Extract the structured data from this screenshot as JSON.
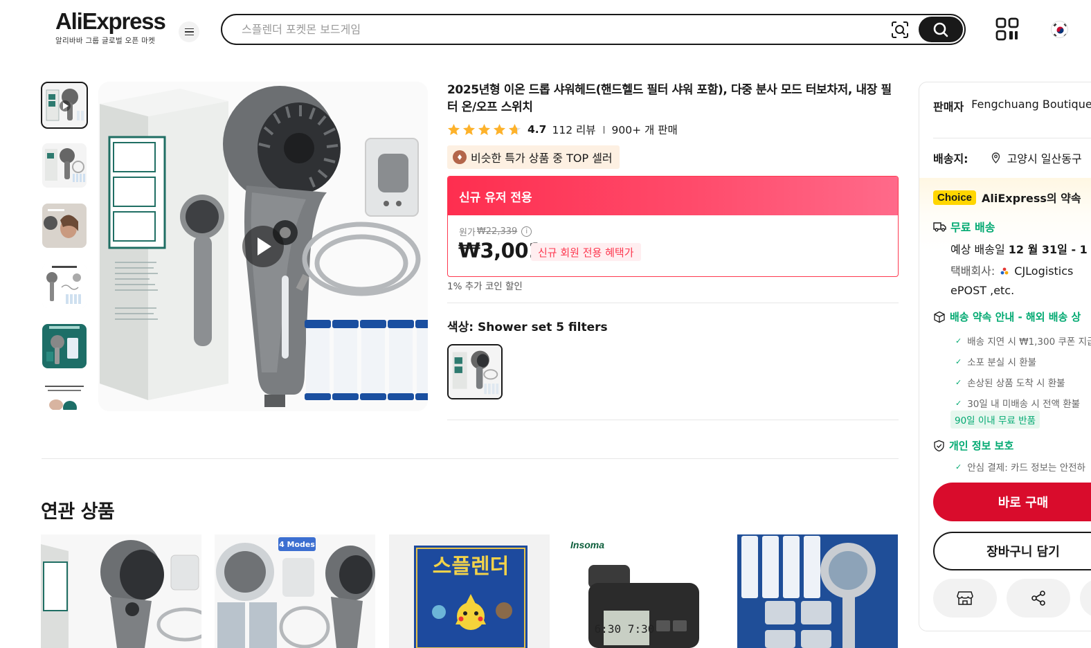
{
  "header": {
    "logo_text": "AliExpress",
    "logo_subtitle": "알리바바 그룹 글로벌 오픈 마켓",
    "search_placeholder": "스플렌더 포켓몬 보드게임"
  },
  "product": {
    "title": "2025년형 이온 드롭 샤워헤드(핸드헬드 필터 샤워 포함), 다중 분사 모드 터보차저, 내장 필터 온/오프 스위치",
    "rating": "4.7",
    "reviews": "112 리뷰",
    "sold": "900+ 개 판매",
    "star_fill_fraction": 0.94,
    "top_seller_badge": "비슷한 특가 상품 중 TOP 셀러",
    "promo_header": "신규 유저 전용",
    "original_price_label": "원가",
    "original_price": "₩22,339",
    "price": "₩3,001",
    "price_badge": "신규 회원 전용 혜택가",
    "coin_discount": "1% 추가 코인 할인",
    "color_label": "색상:",
    "color_value": "Shower set 5 filters"
  },
  "related": {
    "title": "연관 상품",
    "card_labels": [
      "4 Modes",
      "스플렌더",
      "Insoma"
    ]
  },
  "panel": {
    "seller_label": "판매자",
    "seller_name": "Fengchuang Boutique",
    "ship_label": "배송지:",
    "ship_address": "고양시 일산동구",
    "choice_tag": "Choice",
    "choice_title": "AliExpress의 약속",
    "free_shipping": "무료 배송",
    "eta_prefix": "예상 배송일",
    "eta_date": "12 월 31일 - 1",
    "carrier_label": "택배회사:",
    "carrier_name": "CJLogistics",
    "carrier_more": "ePOST ,etc.",
    "promise_title": "배송 약속 안내 - 해외 배송 상",
    "promise_items": [
      "배송 지연 시 ₩1,300 쿠폰 지급",
      "소포 분실 시 환불",
      "손상된 상품 도착 시 환불",
      "30일 내 미배송 시 전액 환불"
    ],
    "return_badge": "90일 이내 무료 반품",
    "privacy_title": "개인 정보 보호",
    "privacy_item": "안심 결제: 카드 정보는 안전하",
    "buy_now": "바로 구매",
    "add_to_cart": "장바구니 담기"
  },
  "colors": {
    "brand_red": "#fd384f",
    "buy_red": "#d90c2c",
    "green": "#01a971",
    "star": "#fdb22b",
    "choice_yellow": "#ffd600"
  }
}
